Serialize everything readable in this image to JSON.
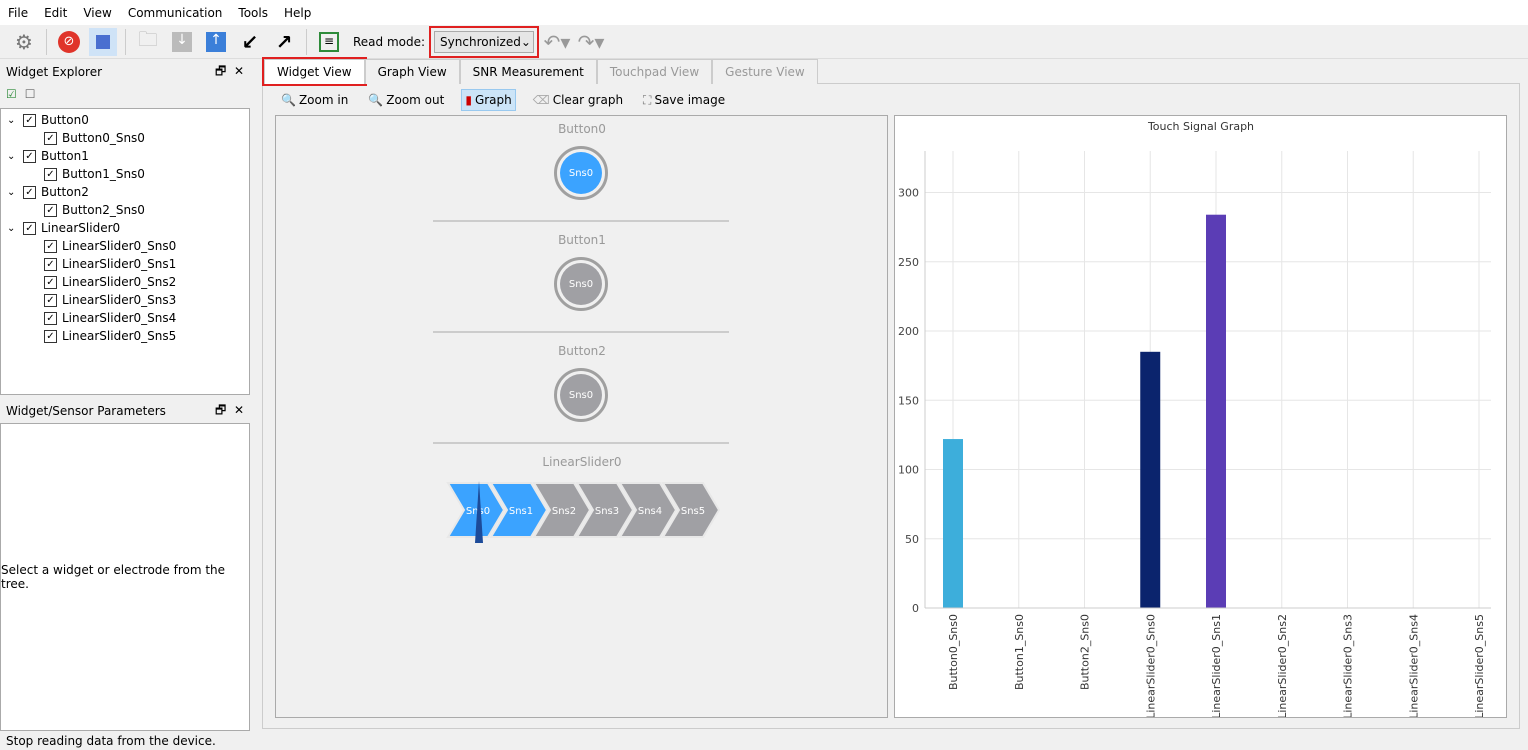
{
  "menu": [
    "File",
    "Edit",
    "View",
    "Communication",
    "Tools",
    "Help"
  ],
  "toolbar": {
    "read_mode_label": "Read mode:",
    "read_mode_value": "Synchronized",
    "icons": [
      "gear-icon",
      "stop-reading-icon",
      "stop-icon",
      "open-folder-icon",
      "import-icon",
      "export-icon",
      "import-arrow-icon",
      "export-arrow-icon",
      "log-icon",
      "undo-icon",
      "redo-icon"
    ]
  },
  "widget_explorer": {
    "title": "Widget Explorer",
    "tree": [
      {
        "label": "Button0",
        "children": [
          "Button0_Sns0"
        ]
      },
      {
        "label": "Button1",
        "children": [
          "Button1_Sns0"
        ]
      },
      {
        "label": "Button2",
        "children": [
          "Button2_Sns0"
        ]
      },
      {
        "label": "LinearSlider0",
        "children": [
          "LinearSlider0_Sns0",
          "LinearSlider0_Sns1",
          "LinearSlider0_Sns2",
          "LinearSlider0_Sns3",
          "LinearSlider0_Sns4",
          "LinearSlider0_Sns5"
        ]
      }
    ]
  },
  "params": {
    "title": "Widget/Sensor Parameters",
    "message": "Select a widget or electrode from the tree."
  },
  "tabs": [
    {
      "label": "Widget View",
      "state": "active"
    },
    {
      "label": "Graph View",
      "state": "normal"
    },
    {
      "label": "SNR Measurement",
      "state": "normal"
    },
    {
      "label": "Touchpad View",
      "state": "disabled"
    },
    {
      "label": "Gesture View",
      "state": "disabled"
    }
  ],
  "subtoolbar": {
    "zoom_in": "Zoom in",
    "zoom_out": "Zoom out",
    "graph": "Graph",
    "clear_graph": "Clear graph",
    "save_image": "Save image"
  },
  "widgets": {
    "buttons": [
      {
        "name": "Button0",
        "sensor": "Sns0",
        "active": true
      },
      {
        "name": "Button1",
        "sensor": "Sns0",
        "active": false
      },
      {
        "name": "Button2",
        "sensor": "Sns0",
        "active": false
      }
    ],
    "slider": {
      "name": "LinearSlider0",
      "segments": [
        "Sns0",
        "Sns1",
        "Sns2",
        "Sns3",
        "Sns4",
        "Sns5"
      ],
      "active": [
        true,
        true,
        false,
        false,
        false,
        false
      ]
    },
    "active_color": "#3ba3ff",
    "inactive_color": "#a0a0a4"
  },
  "status": "Stop reading data from the device.",
  "chart_data": {
    "type": "bar",
    "title": "Touch Signal Graph",
    "categories": [
      "Button0_Sns0",
      "Button1_Sns0",
      "Button2_Sns0",
      "LinearSlider0_Sns0",
      "LinearSlider0_Sns1",
      "LinearSlider0_Sns2",
      "LinearSlider0_Sns3",
      "LinearSlider0_Sns4",
      "LinearSlider0_Sns5"
    ],
    "values": [
      122,
      0,
      0,
      185,
      284,
      0,
      0,
      0,
      0
    ],
    "colors": [
      "#3daedb",
      "#888",
      "#888",
      "#0b246d",
      "#5b3db5",
      "#888",
      "#888",
      "#888",
      "#888"
    ],
    "ylim": [
      0,
      330
    ],
    "yticks": [
      0,
      50,
      100,
      150,
      200,
      250,
      300
    ],
    "grid": true
  }
}
